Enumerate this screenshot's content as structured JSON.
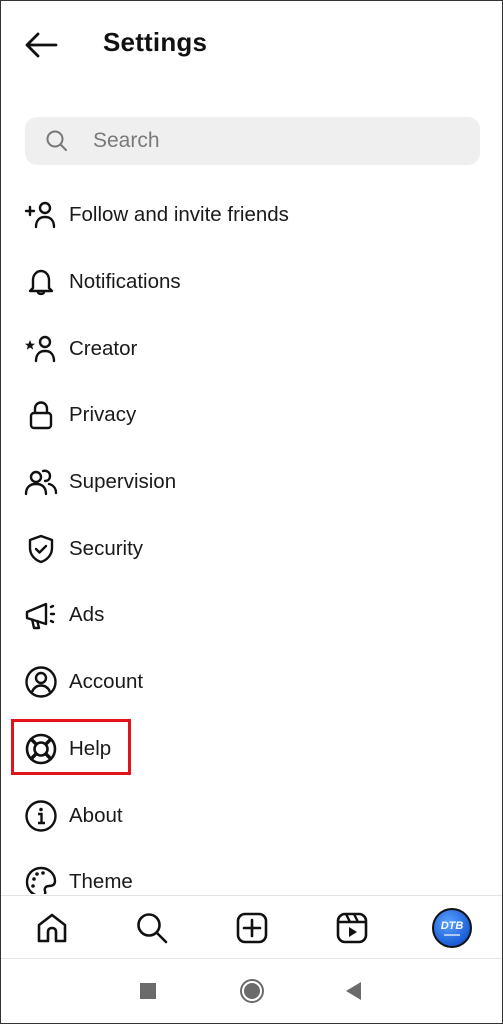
{
  "header": {
    "title": "Settings",
    "back_icon": "arrow-left-icon"
  },
  "search": {
    "placeholder": "Search",
    "value": "",
    "icon": "search-icon"
  },
  "menu": {
    "items": [
      {
        "label": "Follow and invite friends",
        "icon": "add-person-icon"
      },
      {
        "label": "Notifications",
        "icon": "bell-icon"
      },
      {
        "label": "Creator",
        "icon": "star-person-icon"
      },
      {
        "label": "Privacy",
        "icon": "lock-icon"
      },
      {
        "label": "Supervision",
        "icon": "people-icon"
      },
      {
        "label": "Security",
        "icon": "shield-check-icon"
      },
      {
        "label": "Ads",
        "icon": "megaphone-icon"
      },
      {
        "label": "Account",
        "icon": "account-circle-icon"
      },
      {
        "label": "Help",
        "icon": "lifebuoy-icon",
        "highlighted": true
      },
      {
        "label": "About",
        "icon": "info-icon"
      },
      {
        "label": "Theme",
        "icon": "palette-icon"
      }
    ]
  },
  "highlight_color": "#e0121a",
  "tabbar": {
    "tabs": [
      {
        "name": "home",
        "icon": "home-icon"
      },
      {
        "name": "search",
        "icon": "search-icon"
      },
      {
        "name": "create",
        "icon": "plus-square-icon"
      },
      {
        "name": "reels",
        "icon": "reels-icon"
      },
      {
        "name": "profile",
        "icon": "avatar"
      }
    ],
    "avatar_text": "DTB",
    "avatar_color": "#1a5fd6"
  },
  "system_nav": {
    "buttons": [
      "recents",
      "home",
      "back"
    ]
  }
}
